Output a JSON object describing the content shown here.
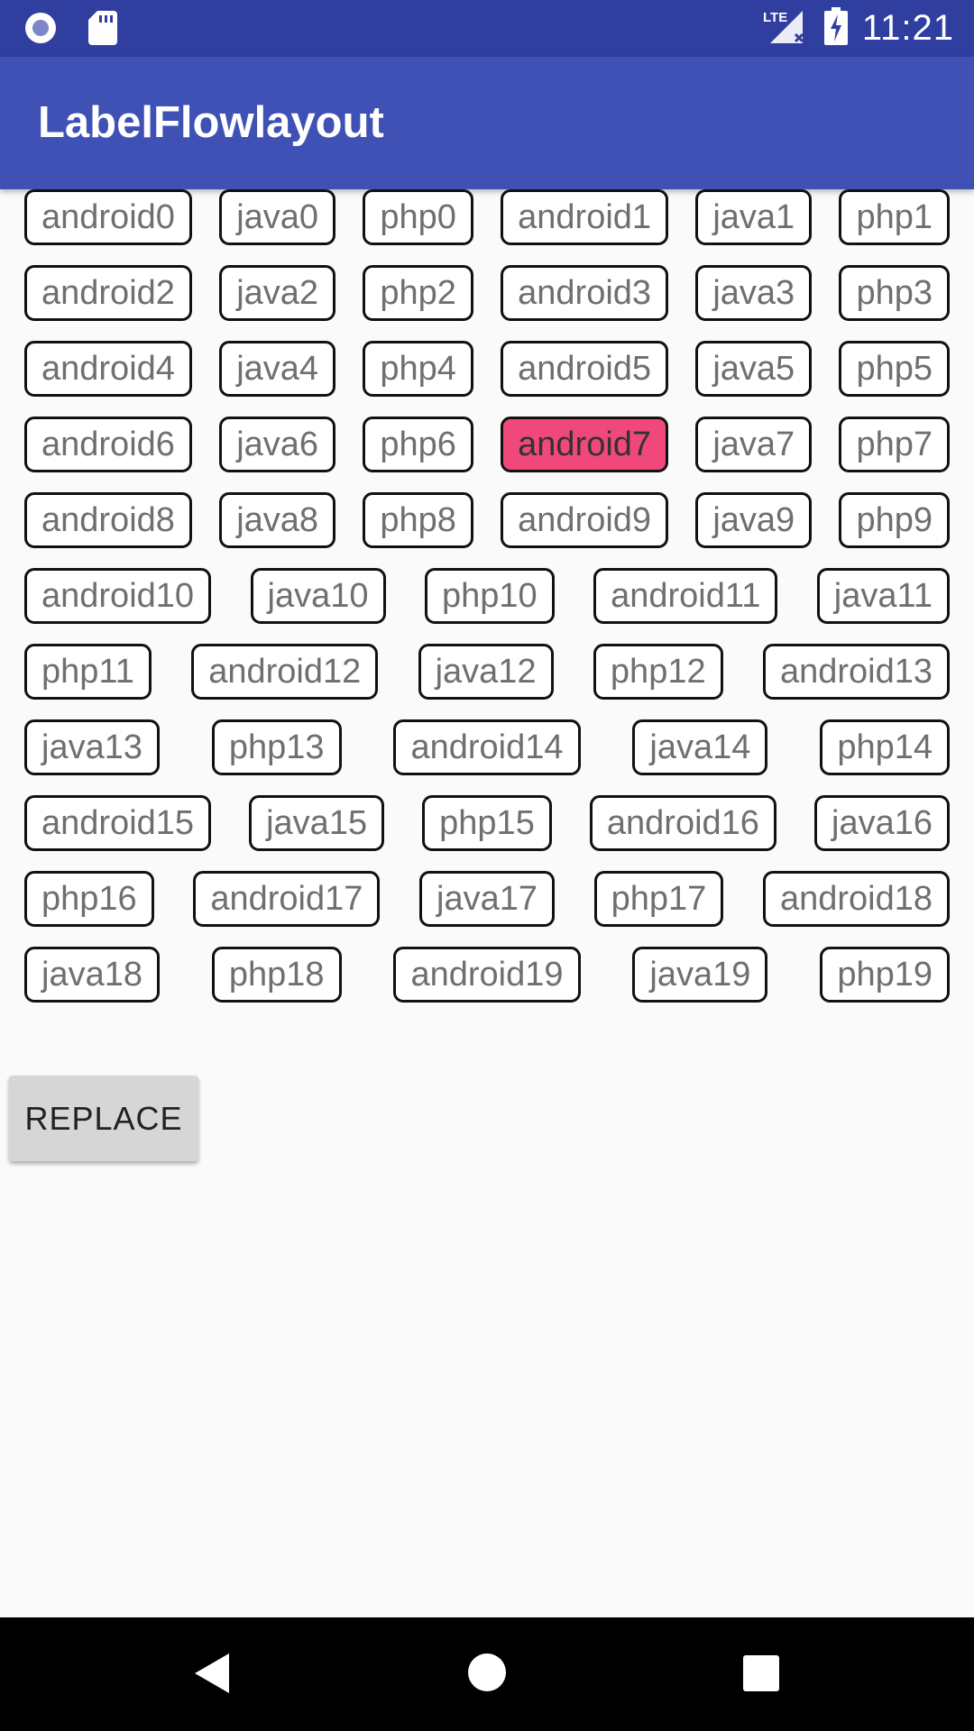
{
  "status_bar": {
    "time": "11:21",
    "network": "LTE",
    "icons": [
      "record-icon",
      "sd-card-icon",
      "signal-icon",
      "battery-charging-icon"
    ]
  },
  "app_bar": {
    "title": "LabelFlowlayout"
  },
  "labels": {
    "selected": "android7",
    "selected_color": "#F0487A",
    "rows": [
      [
        "android0",
        "java0",
        "php0",
        "android1",
        "java1",
        "php1"
      ],
      [
        "android2",
        "java2",
        "php2",
        "android3",
        "java3",
        "php3"
      ],
      [
        "android4",
        "java4",
        "php4",
        "android5",
        "java5",
        "php5"
      ],
      [
        "android6",
        "java6",
        "php6",
        "android7",
        "java7",
        "php7"
      ],
      [
        "android8",
        "java8",
        "php8",
        "android9",
        "java9",
        "php9"
      ],
      [
        "android10",
        "java10",
        "php10",
        "android11",
        "java11"
      ],
      [
        "php11",
        "android12",
        "java12",
        "php12",
        "android13"
      ],
      [
        "java13",
        "php13",
        "android14",
        "java14",
        "php14"
      ],
      [
        "android15",
        "java15",
        "php15",
        "android16",
        "java16"
      ],
      [
        "php16",
        "android17",
        "java17",
        "php17",
        "android18"
      ],
      [
        "java18",
        "php18",
        "android19",
        "java19",
        "php19"
      ]
    ]
  },
  "actions": {
    "replace_label": "REPLACE"
  },
  "nav_bar": {
    "icons": [
      "back-icon",
      "home-icon",
      "recents-icon"
    ]
  },
  "colors": {
    "primary": "#3F51B5",
    "primary_dark": "#303F9F",
    "accent": "#F0487A"
  }
}
